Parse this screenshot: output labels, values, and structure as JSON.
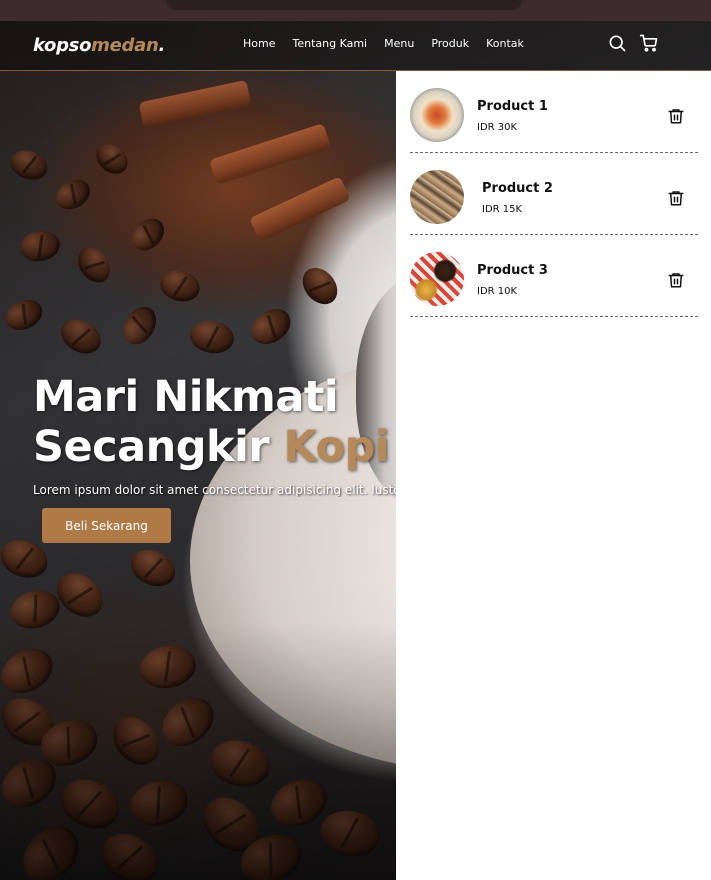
{
  "brand": {
    "logo_main": "kopso",
    "logo_accent": "medan",
    "logo_dot": "."
  },
  "nav": {
    "links": [
      "Home",
      "Tentang Kami",
      "Menu",
      "Produk",
      "Kontak"
    ],
    "icons": [
      "search-icon",
      "shopping-cart-icon"
    ]
  },
  "hero": {
    "title_line1": "Mari Nikmati",
    "title_line2_prefix": "Secangkir ",
    "title_line2_accent": "Kopi",
    "subtitle": "Lorem ipsum dolor sit amet consectetur adipisicing elit. Iusto",
    "cta_label": "Beli Sekarang"
  },
  "cart": {
    "items": [
      {
        "name": "Product 1",
        "price": "IDR 30K"
      },
      {
        "name": "Product 2",
        "price": "IDR 15K"
      },
      {
        "name": "Product 3",
        "price": "IDR 10K"
      }
    ]
  },
  "colors": {
    "accent": "#b6895b",
    "button": "#b07a47",
    "panel": "#ffffff"
  }
}
